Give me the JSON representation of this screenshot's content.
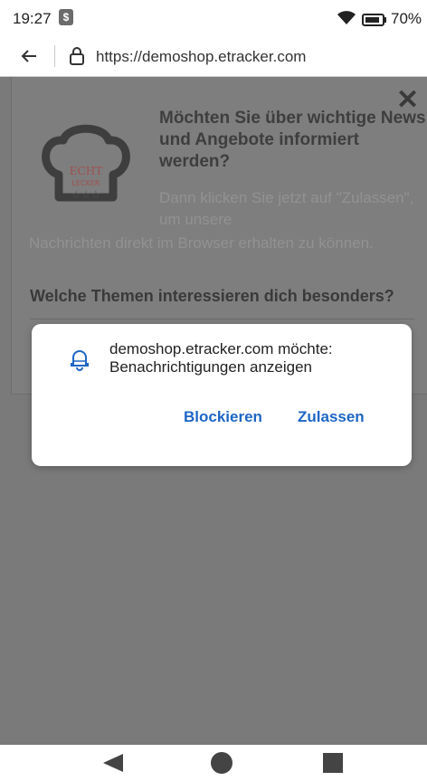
{
  "status_bar": {
    "time": "19:27",
    "app_icon_glyph": "$",
    "battery": "70%",
    "icons": [
      "wifi-icon",
      "battery-icon"
    ]
  },
  "url_bar": {
    "url": "https://demoshop.etracker.com",
    "icons": [
      "back-arrow-icon",
      "lock-icon"
    ]
  },
  "page": {
    "headline": "Möchten Sie über wichtige News und Angebote informiert werden?",
    "sub_text_1": "Dann klicken Sie jetzt auf \"Zulassen\", um unsere",
    "sub_text_2": "Nachrichten direkt im Browser erhalten zu können.",
    "topics_heading": "Welche Themen interessieren dich besonders?",
    "logo": {
      "lines": [
        "ECHT",
        "LECKER"
      ]
    }
  },
  "dialog": {
    "message": "demoshop.etracker.com möchte: Benachrichtigungen anzeigen",
    "block_label": "Blockieren",
    "allow_label": "Zulassen",
    "accent_color": "#1e66c6"
  },
  "nav_bar": {
    "icons": [
      "nav-back-icon",
      "nav-home-icon",
      "nav-recents-icon"
    ]
  }
}
